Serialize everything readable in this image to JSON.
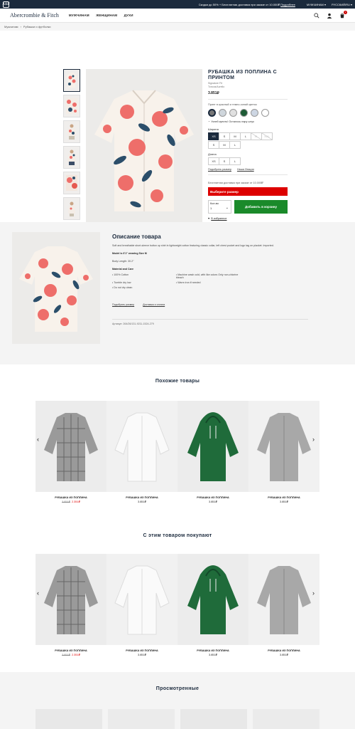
{
  "promo": {
    "logo": "A&F",
    "message": "Скидки до 50% + Бесплатная доставка при заказе от 10.000₽",
    "message_link": "Подробнее",
    "gender": "МУЖЧИНАМ ▾",
    "language": "РУССКИЙ/RU ▾"
  },
  "header": {
    "brand": "Abercrombie & Fitch",
    "nav": [
      "МУЖЧИНАМ",
      "ЖЕНЩИНАМ",
      "ДУХИ"
    ],
    "cart_count": "1"
  },
  "breadcrumbs": [
    "Мужчинам",
    "Рубашки и футболки"
  ],
  "product": {
    "title": "РУБАШКА ИЗ ПОПЛИНА С ПРИНТОМ",
    "subtitle": "Signature Fit",
    "subtitle2": "Tonous/Aurelio",
    "price": "3.851₽",
    "color_label": "Принт в красный и темно-синий цветок",
    "swatch_colors": [
      "#777777",
      "#cfd6dc",
      "#e0e0e0",
      "#1e5b36",
      "#cdd6e3",
      "#ffffff"
    ],
    "hint": "Успей купить! Осталось пару штук",
    "size_label": "Ширина",
    "sizes_row1": [
      "XS",
      "S",
      "M",
      "L",
      "XL",
      "XXL"
    ],
    "sizes_row1_na": [
      false,
      false,
      false,
      false,
      true,
      true
    ],
    "sizes_row2": [
      "S",
      "M",
      "L"
    ],
    "length_label": "Длина",
    "length_sizes": [
      "XS",
      "S",
      "L"
    ],
    "size_guide": "Подобрать размер",
    "our_sizes": "Наши Лекции",
    "shipping": "Бесплатная доставка при заказе от 10.000₽",
    "select_size_btn": "Выберите размер",
    "qty_label": "Кол-во",
    "qty_value": "1",
    "add_to_cart": "Добавить в корзину",
    "wishlist": "В избранное"
  },
  "description": {
    "title": "Описание товара",
    "text": "Soft and breathable short-sleeve button up shirt in lightweight cotton featuring classic collar, left chest pocket and logo tag on placket. Imported.",
    "model": "Model is 6'1\" wearing Size M",
    "body_length": "Body Length: 30.2\"",
    "care_title": "Material and Care",
    "care": [
      "100% Cotton",
      "Machine wash cold, with like colors Only non-chlorine bleach",
      "Tumble dry low",
      "Warm iron if needed",
      "Do not dry clean"
    ],
    "link1": "Подобрать размер",
    "link2": "Доставка и оплата",
    "sku": "Артикул: 264/26/131-9211-1524-279"
  },
  "similar": {
    "title": "Похожие товары",
    "items": [
      {
        "name": "РУБАШКА ИЗ ПОПЛИНА",
        "old": "3.851₽",
        "price": "2.351₽",
        "sale": true
      },
      {
        "name": "РУБАШКА ИЗ ПОПЛИНА",
        "old": "",
        "price": "3.851₽",
        "sale": false
      },
      {
        "name": "РУБАШКА ИЗ ПОПЛИНА",
        "old": "",
        "price": "3.851₽",
        "sale": false
      },
      {
        "name": "РУБАШКА ИЗ ПОПЛИНА",
        "old": "",
        "price": "3.851₽",
        "sale": false
      }
    ]
  },
  "bought": {
    "title": "С этим товаром покупают",
    "items": [
      {
        "name": "РУБАШКА ИЗ ПОПЛИНА",
        "old": "3.851₽",
        "price": "2.351₽",
        "sale": true
      },
      {
        "name": "РУБАШКА ИЗ ПОПЛИНА",
        "old": "",
        "price": "3.851₽",
        "sale": false
      },
      {
        "name": "РУБАШКА ИЗ ПОПЛИНА",
        "old": "",
        "price": "3.851₽",
        "sale": false
      },
      {
        "name": "РУБАШКА ИЗ ПОПЛИНА",
        "old": "",
        "price": "3.851₽",
        "sale": false
      }
    ]
  },
  "viewed": {
    "title": "Просмотренные"
  },
  "icons": {
    "prev": "chevron-left-icon",
    "next": "chevron-right-icon"
  }
}
